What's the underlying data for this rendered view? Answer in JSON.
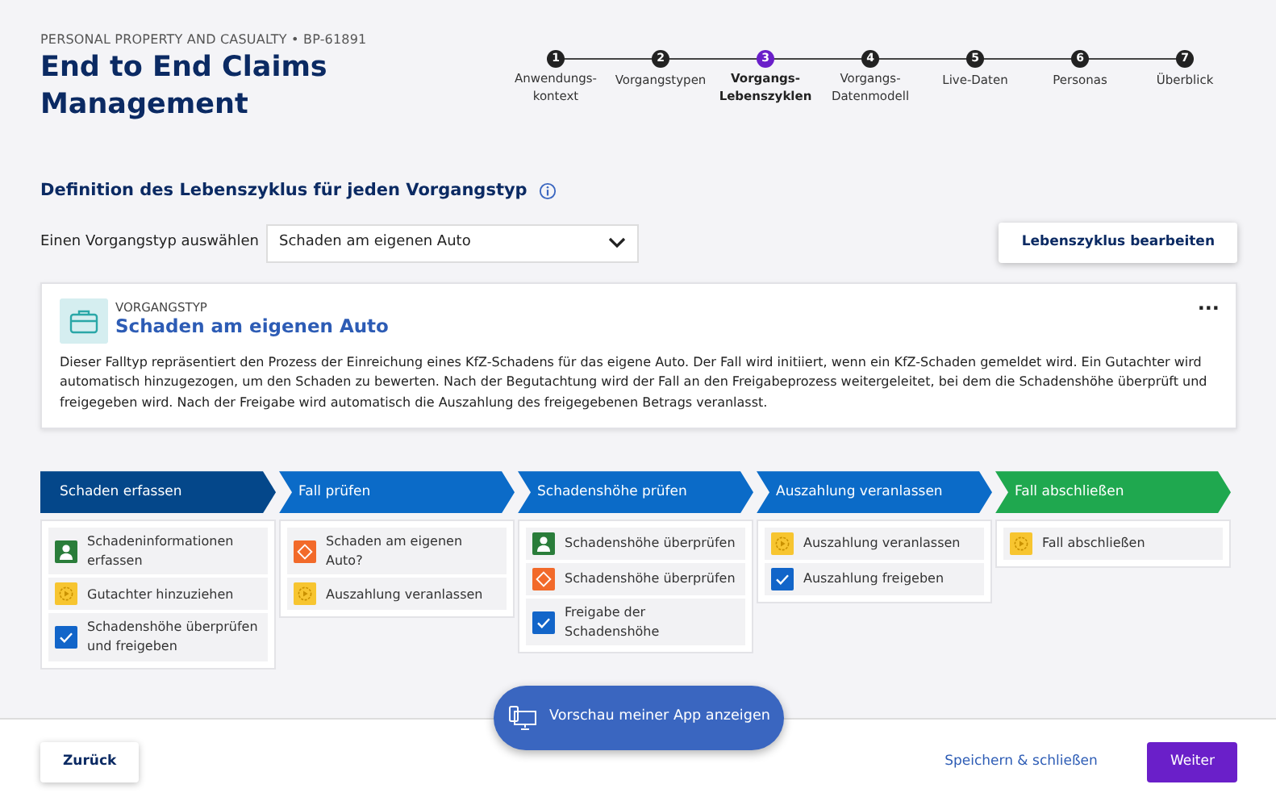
{
  "header": {
    "breadcrumb": "PERSONAL PROPERTY AND CASUALTY • BP-61891",
    "title": "End to End Claims Management"
  },
  "steps": [
    {
      "number": "1",
      "label": "Anwendungs-kontext",
      "selected": false
    },
    {
      "number": "2",
      "label": "Vorgangstypen",
      "selected": false
    },
    {
      "number": "3",
      "label": "Vorgangs-Lebenszyklen",
      "selected": true
    },
    {
      "number": "4",
      "label": "Vorgangs-Datenmodell",
      "selected": false
    },
    {
      "number": "5",
      "label": "Live-Daten",
      "selected": false
    },
    {
      "number": "6",
      "label": "Personas",
      "selected": false
    },
    {
      "number": "7",
      "label": "Überblick",
      "selected": false
    }
  ],
  "section": {
    "title": "Definition des Lebenszyklus für jeden Vorgangstyp"
  },
  "selector": {
    "label": "Einen Vorgangstyp auswählen",
    "value": "Schaden am eigenen Auto"
  },
  "edit_button": "Lebenszyklus bearbeiten",
  "case_type": {
    "eyebrow": "VORGANGSTYP",
    "name": "Schaden am eigenen Auto",
    "menu": "···",
    "description": "Dieser Falltyp repräsentiert den Prozess der Einreichung eines KfZ-Schadens für das eigene Auto. Der Fall wird initiiert, wenn ein KfZ-Schaden gemeldet wird. Ein Gutachter wird automatisch hinzugezogen, um den Schaden zu bewerten. Nach der Begutachtung wird der Fall an den Freigabeprozess weitergeleitet, bei dem die Schadenshöhe überprüft und freigegeben wird. Nach der Freigabe wird automatisch die Auszahlung des freigegebenen Betrags veranlasst."
  },
  "stages": [
    {
      "name": "Schaden erfassen",
      "color": "#04478a",
      "tasks": [
        {
          "kind": "user",
          "label": "Schadeninformationen erfassen"
        },
        {
          "kind": "automation",
          "label": "Gutachter hinzuziehen"
        },
        {
          "kind": "approval",
          "label": "Schadenshöhe überprüfen und freigeben"
        }
      ]
    },
    {
      "name": "Fall prüfen",
      "color": "#0b6bc8",
      "tasks": [
        {
          "kind": "decision",
          "label": "Schaden am eigenen Auto?"
        },
        {
          "kind": "automation",
          "label": "Auszahlung veranlassen"
        }
      ]
    },
    {
      "name": "Schadenshöhe prüfen",
      "color": "#0b6bc8",
      "tasks": [
        {
          "kind": "user",
          "label": "Schadenshöhe überprüfen"
        },
        {
          "kind": "decision",
          "label": "Schadenshöhe überprüfen"
        },
        {
          "kind": "approval",
          "label": "Freigabe der Schadenshöhe"
        }
      ]
    },
    {
      "name": "Auszahlung veranlassen",
      "color": "#0b6bc8",
      "tasks": [
        {
          "kind": "automation",
          "label": "Auszahlung veranlassen"
        },
        {
          "kind": "approval",
          "label": "Auszahlung freigeben"
        }
      ]
    },
    {
      "name": "Fall abschließen",
      "color": "#1fa84f",
      "tasks": [
        {
          "kind": "automation",
          "label": "Fall abschließen"
        }
      ]
    }
  ],
  "preview_button": "Vorschau meiner App anzeigen",
  "footer": {
    "back": "Zurück",
    "save": "Speichern & schließen",
    "next": "Weiter"
  }
}
